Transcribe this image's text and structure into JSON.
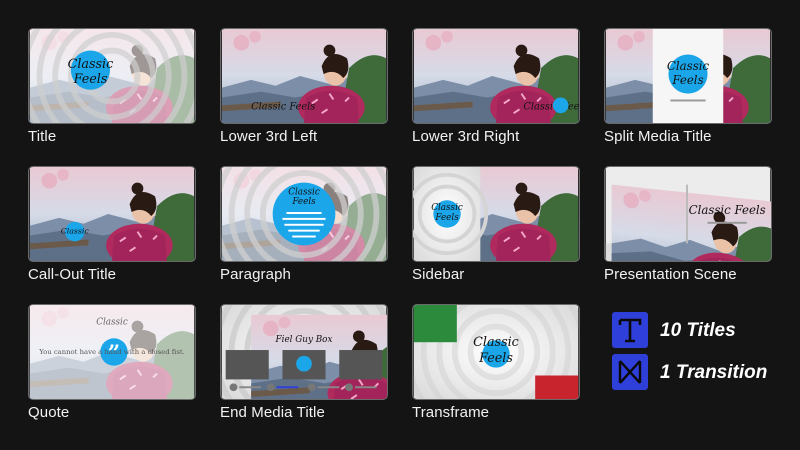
{
  "templates": [
    {
      "label": "Title"
    },
    {
      "label": "Lower 3rd Left"
    },
    {
      "label": "Lower 3rd Right"
    },
    {
      "label": "Split Media Title"
    },
    {
      "label": "Call-Out Title"
    },
    {
      "label": "Paragraph"
    },
    {
      "label": "Sidebar"
    },
    {
      "label": "Presentation Scene"
    },
    {
      "label": "Quote"
    },
    {
      "label": "End Media Title"
    },
    {
      "label": "Transframe"
    }
  ],
  "thumb_text": {
    "brand_line1": "Classic",
    "brand_line2": "Feels",
    "brand_inline": "Classic Feels",
    "quote_body": "You cannot have a hand with a closed fist.",
    "end_title": "Fiel Guy Box"
  },
  "summary": {
    "titles_label": "10 Titles",
    "transitions_label": "1 Transition",
    "titles_icon": "title-T-icon",
    "transition_icon": "bowtie-transition-icon"
  },
  "colors": {
    "accent_blue": "#1ba6ea",
    "badge_blue": "#2f3fd9",
    "background": "#141414"
  }
}
